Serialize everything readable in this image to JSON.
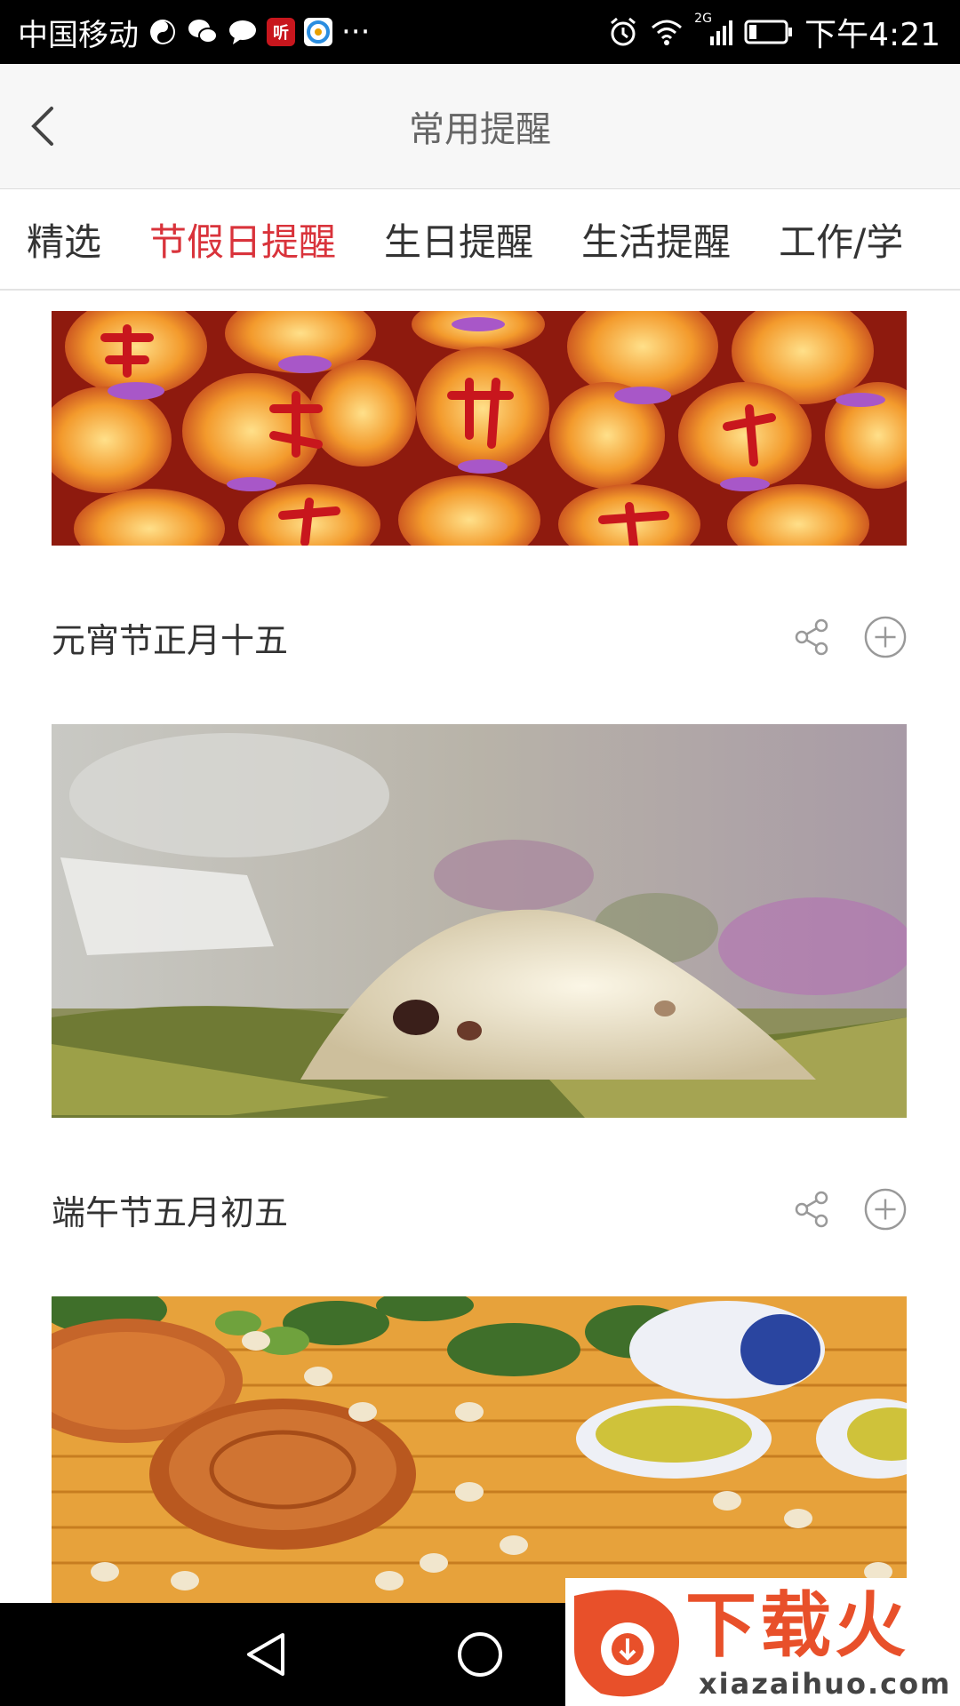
{
  "status_bar": {
    "carrier": "中国移动",
    "notif_badge": "听",
    "more": "···",
    "network": "2G",
    "time": "下午4:21"
  },
  "header": {
    "title": "常用提醒"
  },
  "tabs": [
    {
      "label": "精选"
    },
    {
      "label": "节假日提醒"
    },
    {
      "label": "生日提醒"
    },
    {
      "label": "生活提醒"
    },
    {
      "label": "工作/学"
    }
  ],
  "feed": {
    "items": [
      {
        "title": "元宵节正月十五"
      },
      {
        "title": "端午节五月初五"
      }
    ]
  },
  "watermark": {
    "brand": "下载火",
    "url": "xiazaihuo.com"
  },
  "colors": {
    "accent": "#d9333b",
    "header_bg": "#f7f7f7",
    "text": "#333333"
  }
}
